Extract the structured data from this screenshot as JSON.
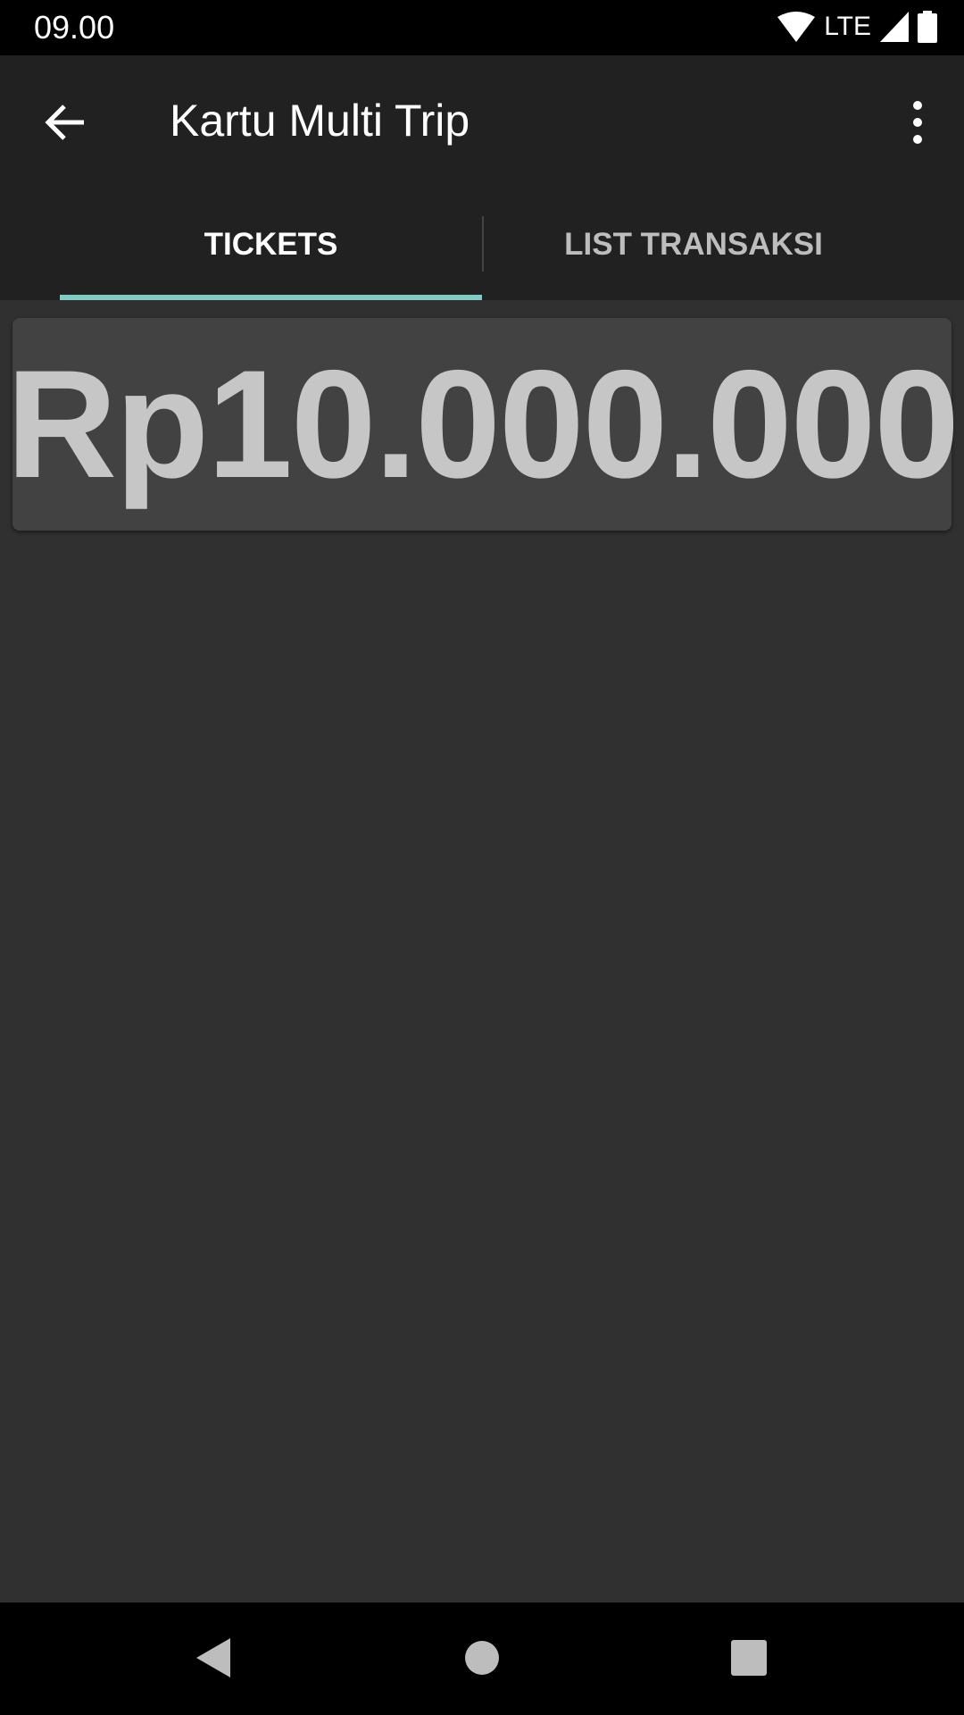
{
  "status_bar": {
    "time": "09.00",
    "network": "LTE",
    "icons": [
      "wifi-icon",
      "signal-icon",
      "battery-icon"
    ]
  },
  "toolbar": {
    "title": "Kartu Multi Trip",
    "back_icon": "arrow-back-icon",
    "menu_icon": "more-vert-icon"
  },
  "tabs": [
    {
      "label": "TICKETS",
      "selected": true
    },
    {
      "label": "LIST TRANSAKSI",
      "selected": false
    }
  ],
  "colors": {
    "accent": "#80cbc4",
    "toolbar": "#212121",
    "background": "#303030",
    "card": "#424242"
  },
  "card": {
    "amount": "Rp10.000.000"
  },
  "nav_bar": {
    "icons": [
      "back-triangle-icon",
      "home-circle-icon",
      "recents-square-icon"
    ]
  }
}
